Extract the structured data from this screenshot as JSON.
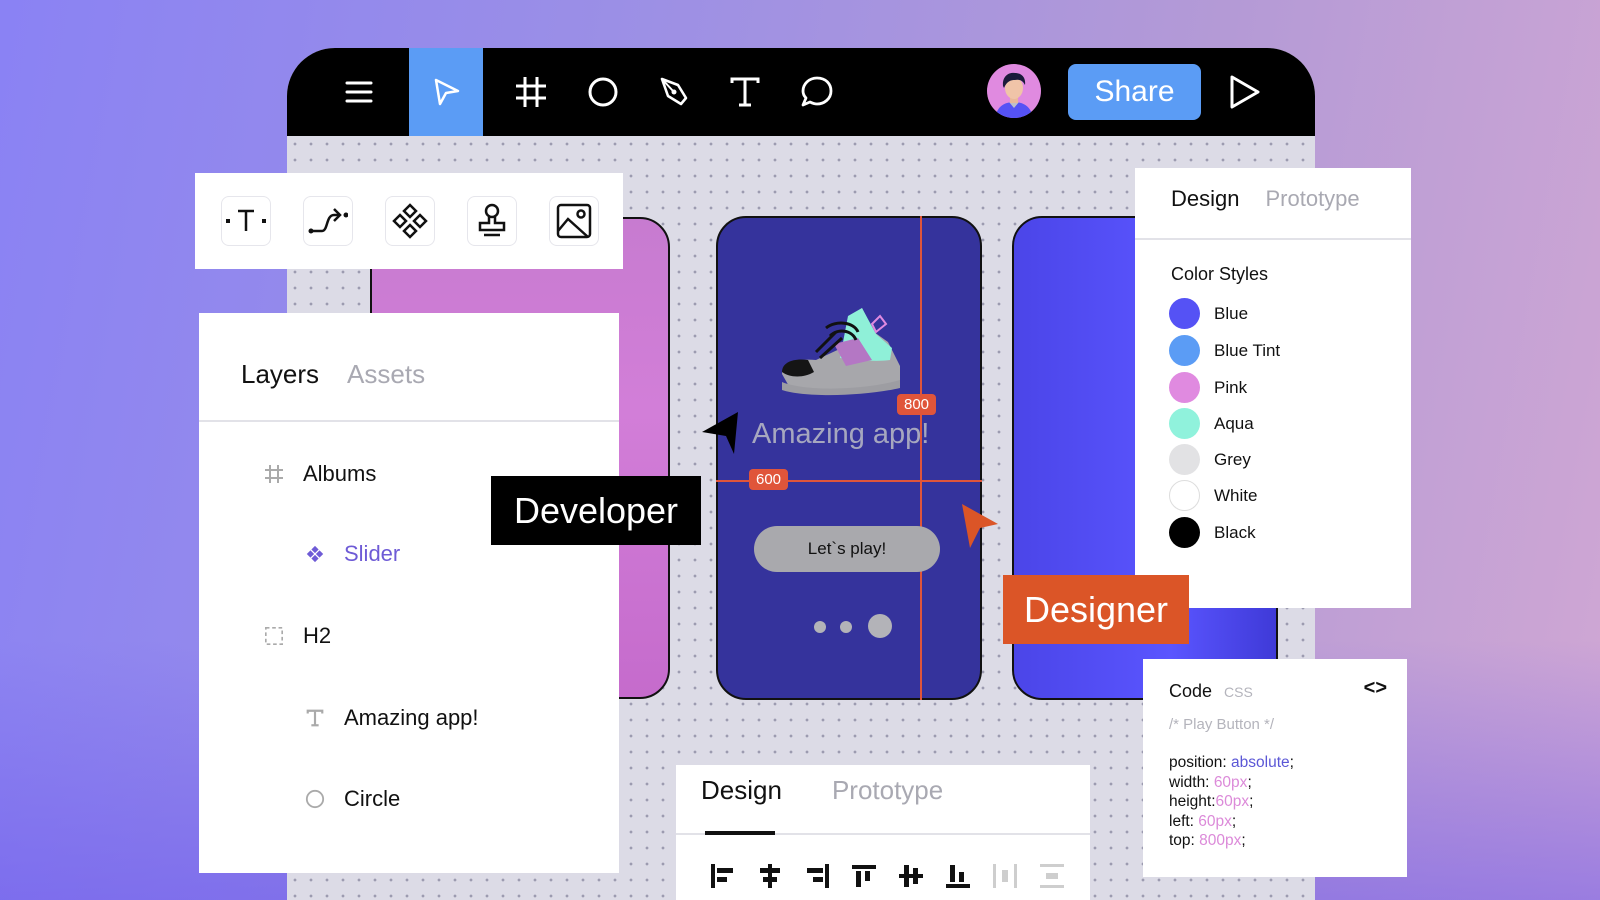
{
  "toolbar": {
    "tools": [
      {
        "name": "menu",
        "icon": "hamburger-menu-icon"
      },
      {
        "name": "move",
        "icon": "cursor-arrow-icon",
        "active": true
      },
      {
        "name": "frame",
        "icon": "frame-hash-icon"
      },
      {
        "name": "ellipse",
        "icon": "circle-icon"
      },
      {
        "name": "pen",
        "icon": "pen-nib-icon"
      },
      {
        "name": "text",
        "icon": "text-t-icon"
      },
      {
        "name": "comment",
        "icon": "speech-bubble-icon"
      }
    ],
    "share_label": "Share",
    "active_color": "#5b9cf5"
  },
  "shape_tools": [
    {
      "name": "text-box",
      "icon": "text-box-icon"
    },
    {
      "name": "connector",
      "icon": "connector-path-icon"
    },
    {
      "name": "component",
      "icon": "component-diamonds-icon"
    },
    {
      "name": "stamp",
      "icon": "stamp-icon"
    },
    {
      "name": "image",
      "icon": "image-icon"
    }
  ],
  "layers_panel": {
    "tabs": [
      "Layers",
      "Assets"
    ],
    "active_tab": "Layers",
    "items": [
      {
        "label": "Albums",
        "icon": "frame-hash-icon",
        "indent": 0
      },
      {
        "label": "Slider",
        "icon": "component-icon",
        "indent": 1,
        "highlight": true
      },
      {
        "label": "H2",
        "icon": "dashed-frame-icon",
        "indent": 0
      },
      {
        "label": "Amazing app!",
        "icon": "text-t-icon",
        "indent": 1
      },
      {
        "label": "Circle",
        "icon": "circle-icon",
        "indent": 1
      }
    ]
  },
  "canvas": {
    "phone_title": "Amazing app!",
    "play_button": "Let`s play!",
    "measure_vertical": "800",
    "measure_horizontal": "600",
    "pager_dots": 3,
    "pager_active": 3
  },
  "cursors": {
    "developer_label": "Developer",
    "designer_label": "Designer",
    "designer_color": "#db5527"
  },
  "design_panel": {
    "tabs": [
      "Design",
      "Prototype"
    ],
    "active_tab": "Design",
    "section_title": "Color Styles",
    "colors": [
      {
        "name": "Blue",
        "hex": "#5552f5"
      },
      {
        "name": "Blue Tint",
        "hex": "#5b9cf5"
      },
      {
        "name": "Pink",
        "hex": "#e08ae0"
      },
      {
        "name": "Aqua",
        "hex": "#90f2dc"
      },
      {
        "name": "Grey",
        "hex": "#e2e2e4"
      },
      {
        "name": "White",
        "hex": "#ffffff"
      },
      {
        "name": "Black",
        "hex": "#000000"
      }
    ]
  },
  "code_panel": {
    "title": "Code",
    "language": "CSS",
    "toggle": "<>",
    "comment": "/* Play Button */",
    "lines": [
      {
        "prop": "position: ",
        "value": "absolute",
        "type": "kw"
      },
      {
        "prop": "width: ",
        "value": "60px",
        "type": "num"
      },
      {
        "prop": "height:",
        "value": "60px",
        "type": "num"
      },
      {
        "prop": "left: ",
        "value": "60px",
        "type": "num"
      },
      {
        "prop": "top: ",
        "value": "800px",
        "type": "num"
      }
    ]
  },
  "bottom_panel": {
    "tabs": [
      "Design",
      "Prototype"
    ],
    "active_tab": "Design",
    "align_buttons": [
      {
        "name": "align-left",
        "enabled": true
      },
      {
        "name": "align-horizontal-center",
        "enabled": true
      },
      {
        "name": "align-right",
        "enabled": true
      },
      {
        "name": "align-top",
        "enabled": true
      },
      {
        "name": "align-vertical-center",
        "enabled": true
      },
      {
        "name": "align-bottom",
        "enabled": true
      },
      {
        "name": "distribute-horizontal",
        "enabled": false
      },
      {
        "name": "distribute-vertical",
        "enabled": false
      }
    ]
  }
}
